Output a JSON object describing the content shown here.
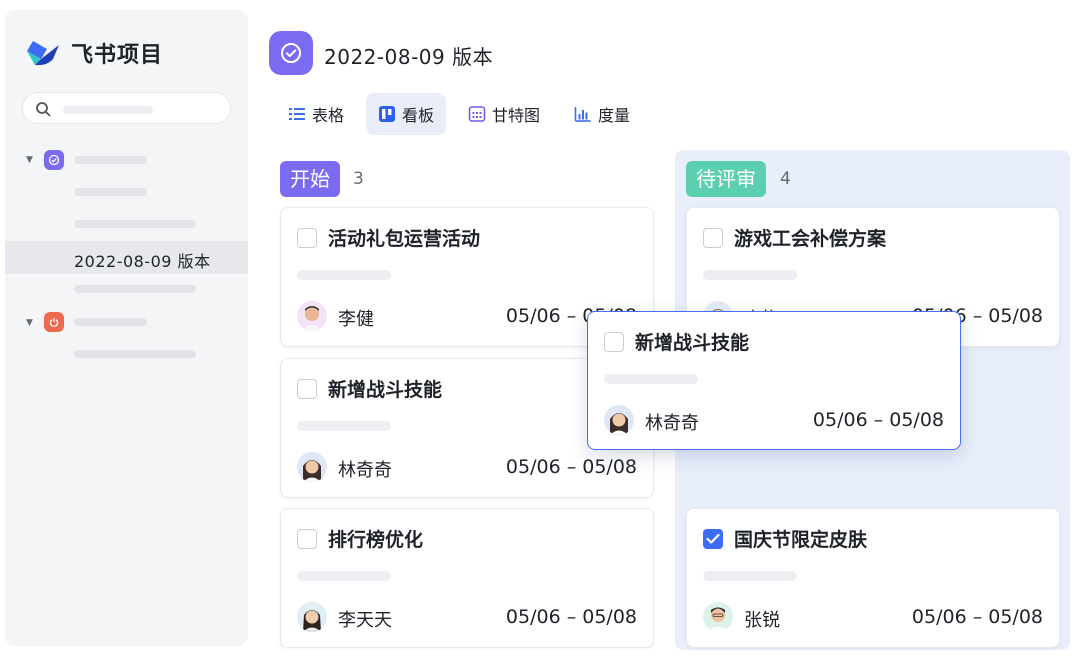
{
  "app": {
    "name": "飞书项目"
  },
  "sidebar": {
    "selected_item": "2022-08-09 版本"
  },
  "header": {
    "title": "2022-08-09 版本"
  },
  "tabs": [
    {
      "label": "表格",
      "icon": "list-icon"
    },
    {
      "label": "看板",
      "icon": "kanban-icon",
      "active": true
    },
    {
      "label": "甘特图",
      "icon": "gantt-icon"
    },
    {
      "label": "度量",
      "icon": "chart-icon"
    }
  ],
  "columns": [
    {
      "name": "开始",
      "count": "3",
      "color": "#7b6bf0",
      "cards": [
        {
          "title": "活动礼包运营活动",
          "owner": "李健",
          "dates": "05/06 – 05/08",
          "checked": false
        },
        {
          "title": "新增战斗技能",
          "owner": "林奇奇",
          "dates": "05/06 – 05/08",
          "checked": false
        },
        {
          "title": "排行榜优化",
          "owner": "李天天",
          "dates": "05/06 – 05/08",
          "checked": false
        }
      ]
    },
    {
      "name": "待评审",
      "count": "4",
      "color": "#5ccfb0",
      "cards": [
        {
          "title": "游戏工会补偿方案",
          "owner": "李梅",
          "dates": "05/06 – 05/08",
          "checked": false
        },
        {
          "title": "国庆节限定皮肤",
          "owner": "张锐",
          "dates": "05/06 – 05/08",
          "checked": true
        }
      ]
    }
  ],
  "dragging_card": {
    "title": "新增战斗技能",
    "owner": "林奇奇",
    "dates": "05/06 – 05/08"
  },
  "colors": {
    "accent": "#7b6bf0",
    "review": "#5ccfb0",
    "checked": "#3d6df5",
    "drag_border": "#4a6cf7"
  }
}
